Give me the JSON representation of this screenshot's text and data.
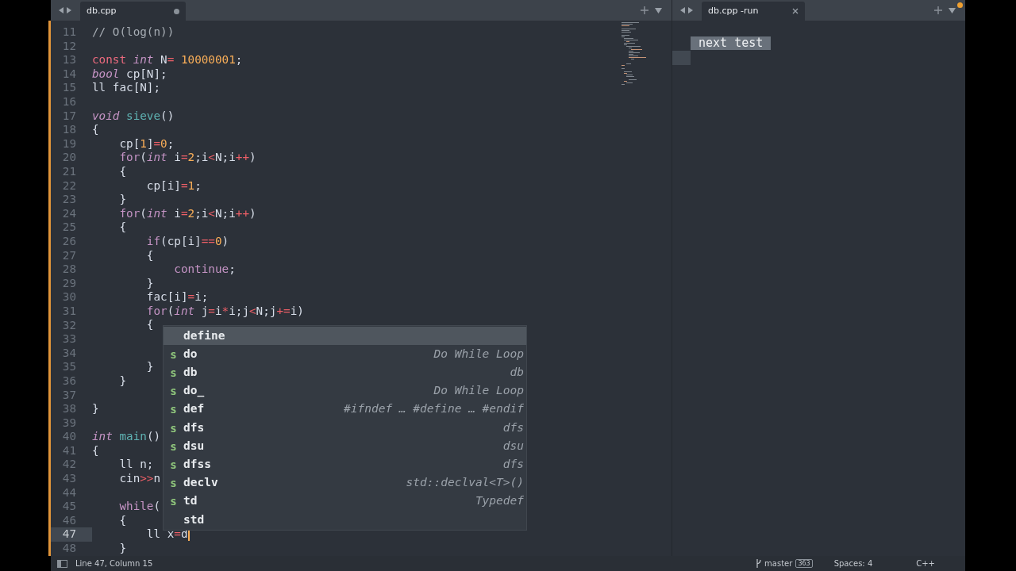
{
  "left_pane": {
    "tab": {
      "title": "db.cpp",
      "modified": true
    },
    "code_lines": [
      {
        "number": "11",
        "current": false,
        "tokens": [
          {
            "kind": "comment",
            "text": "// O(log(n))"
          }
        ]
      },
      {
        "number": "12",
        "current": false
      },
      {
        "number": "13",
        "current": false,
        "tokens": [
          {
            "kind": "storage",
            "text": "const"
          },
          {
            "kind": "type",
            "text": " int"
          },
          {
            "kind": "plain",
            "text": " N"
          },
          {
            "kind": "operator",
            "text": "="
          },
          {
            "kind": "number",
            "text": " 10000001"
          },
          {
            "kind": "plain",
            "text": ";"
          }
        ]
      },
      {
        "number": "14",
        "current": false,
        "tokens": [
          {
            "kind": "type",
            "text": "bool"
          },
          {
            "kind": "plain",
            "text": " cp[N];"
          }
        ]
      },
      {
        "number": "15",
        "current": false,
        "tokens": [
          {
            "kind": "plain",
            "text": "ll fac[N];"
          }
        ]
      },
      {
        "number": "16",
        "current": false
      },
      {
        "number": "17",
        "current": false,
        "tokens": [
          {
            "kind": "type",
            "text": "void"
          },
          {
            "kind": "function",
            "text": " sieve"
          },
          {
            "kind": "plain",
            "text": "()"
          }
        ]
      },
      {
        "number": "18",
        "current": false,
        "tokens": [
          {
            "kind": "plain",
            "text": "{"
          }
        ]
      },
      {
        "number": "19",
        "current": false,
        "tokens": [
          {
            "kind": "plain",
            "text": "    cp["
          },
          {
            "kind": "number",
            "text": "1"
          },
          {
            "kind": "plain",
            "text": "]"
          },
          {
            "kind": "operator",
            "text": "="
          },
          {
            "kind": "number",
            "text": "0"
          },
          {
            "kind": "plain",
            "text": ";"
          }
        ]
      },
      {
        "number": "20",
        "current": false,
        "tokens": [
          {
            "kind": "control",
            "text": "    for"
          },
          {
            "kind": "plain",
            "text": "("
          },
          {
            "kind": "type",
            "text": "int"
          },
          {
            "kind": "plain",
            "text": " i"
          },
          {
            "kind": "operator",
            "text": "="
          },
          {
            "kind": "number",
            "text": "2"
          },
          {
            "kind": "plain",
            "text": ";i"
          },
          {
            "kind": "operator",
            "text": "<"
          },
          {
            "kind": "plain",
            "text": "N;i"
          },
          {
            "kind": "operator",
            "text": "++"
          },
          {
            "kind": "plain",
            "text": ")"
          }
        ]
      },
      {
        "number": "21",
        "current": false,
        "tokens": [
          {
            "kind": "plain",
            "text": "    {"
          }
        ]
      },
      {
        "number": "22",
        "current": false,
        "tokens": [
          {
            "kind": "plain",
            "text": "        cp[i]"
          },
          {
            "kind": "operator",
            "text": "="
          },
          {
            "kind": "number",
            "text": "1"
          },
          {
            "kind": "plain",
            "text": ";"
          }
        ]
      },
      {
        "number": "23",
        "current": false,
        "tokens": [
          {
            "kind": "plain",
            "text": "    }"
          }
        ]
      },
      {
        "number": "24",
        "current": false,
        "tokens": [
          {
            "kind": "control",
            "text": "    for"
          },
          {
            "kind": "plain",
            "text": "("
          },
          {
            "kind": "type",
            "text": "int"
          },
          {
            "kind": "plain",
            "text": " i"
          },
          {
            "kind": "operator",
            "text": "="
          },
          {
            "kind": "number",
            "text": "2"
          },
          {
            "kind": "plain",
            "text": ";i"
          },
          {
            "kind": "operator",
            "text": "<"
          },
          {
            "kind": "plain",
            "text": "N;i"
          },
          {
            "kind": "operator",
            "text": "++"
          },
          {
            "kind": "plain",
            "text": ")"
          }
        ]
      },
      {
        "number": "25",
        "current": false,
        "tokens": [
          {
            "kind": "plain",
            "text": "    {"
          }
        ]
      },
      {
        "number": "26",
        "current": false,
        "tokens": [
          {
            "kind": "control",
            "text": "        if"
          },
          {
            "kind": "plain",
            "text": "(cp[i]"
          },
          {
            "kind": "operator",
            "text": "=="
          },
          {
            "kind": "number",
            "text": "0"
          },
          {
            "kind": "plain",
            "text": ")"
          }
        ]
      },
      {
        "number": "27",
        "current": false,
        "tokens": [
          {
            "kind": "plain",
            "text": "        {"
          }
        ]
      },
      {
        "number": "28",
        "current": false,
        "tokens": [
          {
            "kind": "control",
            "text": "            continue"
          },
          {
            "kind": "plain",
            "text": ";"
          }
        ]
      },
      {
        "number": "29",
        "current": false,
        "tokens": [
          {
            "kind": "plain",
            "text": "        }"
          }
        ]
      },
      {
        "number": "30",
        "current": false,
        "tokens": [
          {
            "kind": "plain",
            "text": "        fac[i]"
          },
          {
            "kind": "operator",
            "text": "="
          },
          {
            "kind": "plain",
            "text": "i;"
          }
        ]
      },
      {
        "number": "31",
        "current": false,
        "tokens": [
          {
            "kind": "control",
            "text": "        for"
          },
          {
            "kind": "plain",
            "text": "("
          },
          {
            "kind": "type",
            "text": "int"
          },
          {
            "kind": "plain",
            "text": " j"
          },
          {
            "kind": "operator",
            "text": "="
          },
          {
            "kind": "plain",
            "text": "i"
          },
          {
            "kind": "operator",
            "text": "*"
          },
          {
            "kind": "plain",
            "text": "i;j"
          },
          {
            "kind": "operator",
            "text": "<"
          },
          {
            "kind": "plain",
            "text": "N;j"
          },
          {
            "kind": "operator",
            "text": "+="
          },
          {
            "kind": "plain",
            "text": "i)"
          }
        ]
      },
      {
        "number": "32",
        "current": false,
        "tokens": [
          {
            "kind": "plain",
            "text": "        {"
          }
        ]
      },
      {
        "number": "33",
        "current": false
      },
      {
        "number": "34",
        "current": false
      },
      {
        "number": "35",
        "current": false,
        "tokens": [
          {
            "kind": "plain",
            "text": "        }"
          }
        ]
      },
      {
        "number": "36",
        "current": false,
        "tokens": [
          {
            "kind": "plain",
            "text": "    }"
          }
        ]
      },
      {
        "number": "37",
        "current": false
      },
      {
        "number": "38",
        "current": false,
        "tokens": [
          {
            "kind": "plain",
            "text": "}"
          }
        ]
      },
      {
        "number": "39",
        "current": false
      },
      {
        "number": "40",
        "current": false,
        "tokens": [
          {
            "kind": "type",
            "text": "int"
          },
          {
            "kind": "function",
            "text": " main"
          },
          {
            "kind": "plain",
            "text": "()"
          }
        ]
      },
      {
        "number": "41",
        "current": false,
        "tokens": [
          {
            "kind": "plain",
            "text": "{"
          }
        ]
      },
      {
        "number": "42",
        "current": false,
        "tokens": [
          {
            "kind": "plain",
            "text": "    ll n;"
          }
        ]
      },
      {
        "number": "43",
        "current": false,
        "tokens": [
          {
            "kind": "plain",
            "text": "    cin"
          },
          {
            "kind": "operator",
            "text": ">>"
          },
          {
            "kind": "plain",
            "text": "n"
          }
        ]
      },
      {
        "number": "44",
        "current": false
      },
      {
        "number": "45",
        "current": false,
        "tokens": [
          {
            "kind": "control",
            "text": "    while"
          },
          {
            "kind": "plain",
            "text": "("
          }
        ]
      },
      {
        "number": "46",
        "current": false,
        "tokens": [
          {
            "kind": "plain",
            "text": "    {"
          }
        ]
      },
      {
        "number": "47",
        "current": true,
        "tokens": [
          {
            "kind": "plain",
            "text": "        ll x"
          },
          {
            "kind": "operator",
            "text": "="
          },
          {
            "kind": "plain",
            "text": "d"
          }
        ]
      },
      {
        "number": "48",
        "current": false,
        "tokens": [
          {
            "kind": "plain",
            "text": "    }"
          }
        ]
      }
    ],
    "completions": [
      {
        "kind": "word",
        "name": "define",
        "selected": true
      },
      {
        "kind": "snippet",
        "icon": "s",
        "name": "do",
        "description": "Do While Loop",
        "selected": false
      },
      {
        "kind": "snippet",
        "icon": "s",
        "name": "db",
        "description": "db",
        "selected": false
      },
      {
        "kind": "snippet",
        "icon": "s",
        "name": "do_",
        "description": "Do While Loop",
        "selected": false
      },
      {
        "kind": "snippet",
        "icon": "s",
        "name": "def",
        "description": "#ifndef … #define … #endif",
        "selected": false
      },
      {
        "kind": "snippet",
        "icon": "s",
        "name": "dfs",
        "description": "dfs",
        "selected": false
      },
      {
        "kind": "snippet",
        "icon": "s",
        "name": "dsu",
        "description": "dsu",
        "selected": false
      },
      {
        "kind": "snippet",
        "icon": "s",
        "name": "dfss",
        "description": "dfs",
        "selected": false
      },
      {
        "kind": "snippet",
        "icon": "s",
        "name": "declv",
        "description": "std::declval<T>()",
        "selected": false
      },
      {
        "kind": "snippet",
        "icon": "s",
        "name": "td",
        "description": "Typedef",
        "selected": false
      },
      {
        "kind": "word",
        "name": "std",
        "selected": false
      }
    ]
  },
  "right_pane": {
    "tab": {
      "title": "db.cpp -run",
      "modified": false
    },
    "output": "next test"
  },
  "status_bar": {
    "cursor": "Line 47, Column 15",
    "branch": "master",
    "branch_count": "363",
    "indentation": "Spaces: 4",
    "syntax": "C++"
  }
}
